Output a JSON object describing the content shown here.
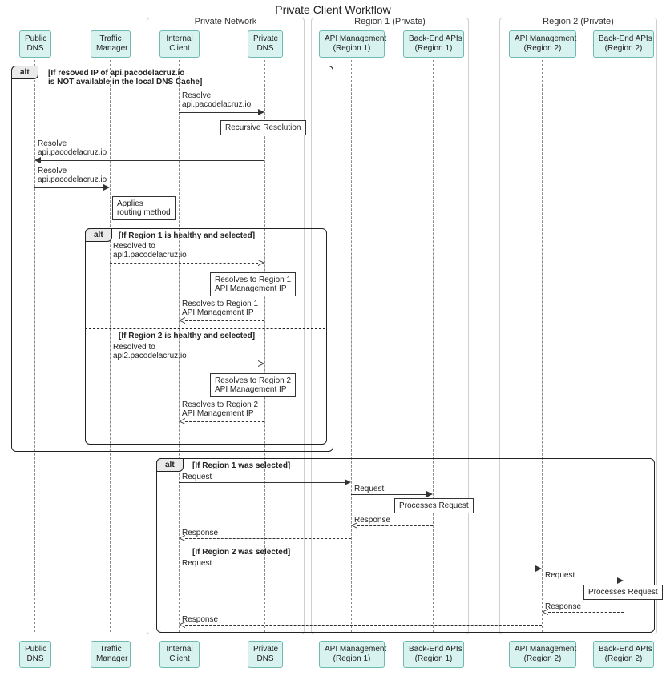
{
  "title": "Private Client Workflow",
  "participants": {
    "publicDNS": "Public\nDNS",
    "trafficManager": "Traffic\nManager",
    "internalClient": "Internal\nClient",
    "privateDNS": "Private\nDNS",
    "apim1": "API Management\n(Region 1)",
    "be1": "Back-End APIs\n(Region 1)",
    "apim2": "API Management\n(Region 2)",
    "be2": "Back-End APIs\n(Region 2)"
  },
  "groups": {
    "privateNetwork": "Private Network",
    "region1": "Region 1 (Private)",
    "region2": "Region 2 (Private)"
  },
  "alt1": {
    "tab": "alt",
    "guard": "[If resoved IP of api.pacodelacruz.io\nis NOT available in the local DNS Cache]"
  },
  "msgs": {
    "resolve1": "Resolve\napi.pacodelacruz.io",
    "recursive": "Recursive Resolution",
    "resolve2": "Resolve\napi.pacodelacruz.io",
    "resolve3": "Resolve\napi.pacodelacruz.io",
    "applies": "Applies\nrouting method"
  },
  "alt2": {
    "tab": "alt",
    "guard1": "[If Region 1 is healthy and selected]",
    "resolved1": "Resolved to\napi1.pacodelacruz.io",
    "note1": "Resolves to Region 1\nAPI Management IP",
    "return1": "Resolves to Region 1\nAPI Management IP",
    "guard2": "[If Region 2 is healthy and selected]",
    "resolved2": "Resolved to\napi2.pacodelacruz.io",
    "note2": "Resolves to Region 2\nAPI Management IP",
    "return2": "Resolves to Region 2\nAPI Management IP"
  },
  "alt3": {
    "tab": "alt",
    "guard1": "[If Region 1 was selected]",
    "req": "Request",
    "procNote": "Processes Request",
    "resp": "Response",
    "guard2": "[If Region 2 was selected]"
  }
}
